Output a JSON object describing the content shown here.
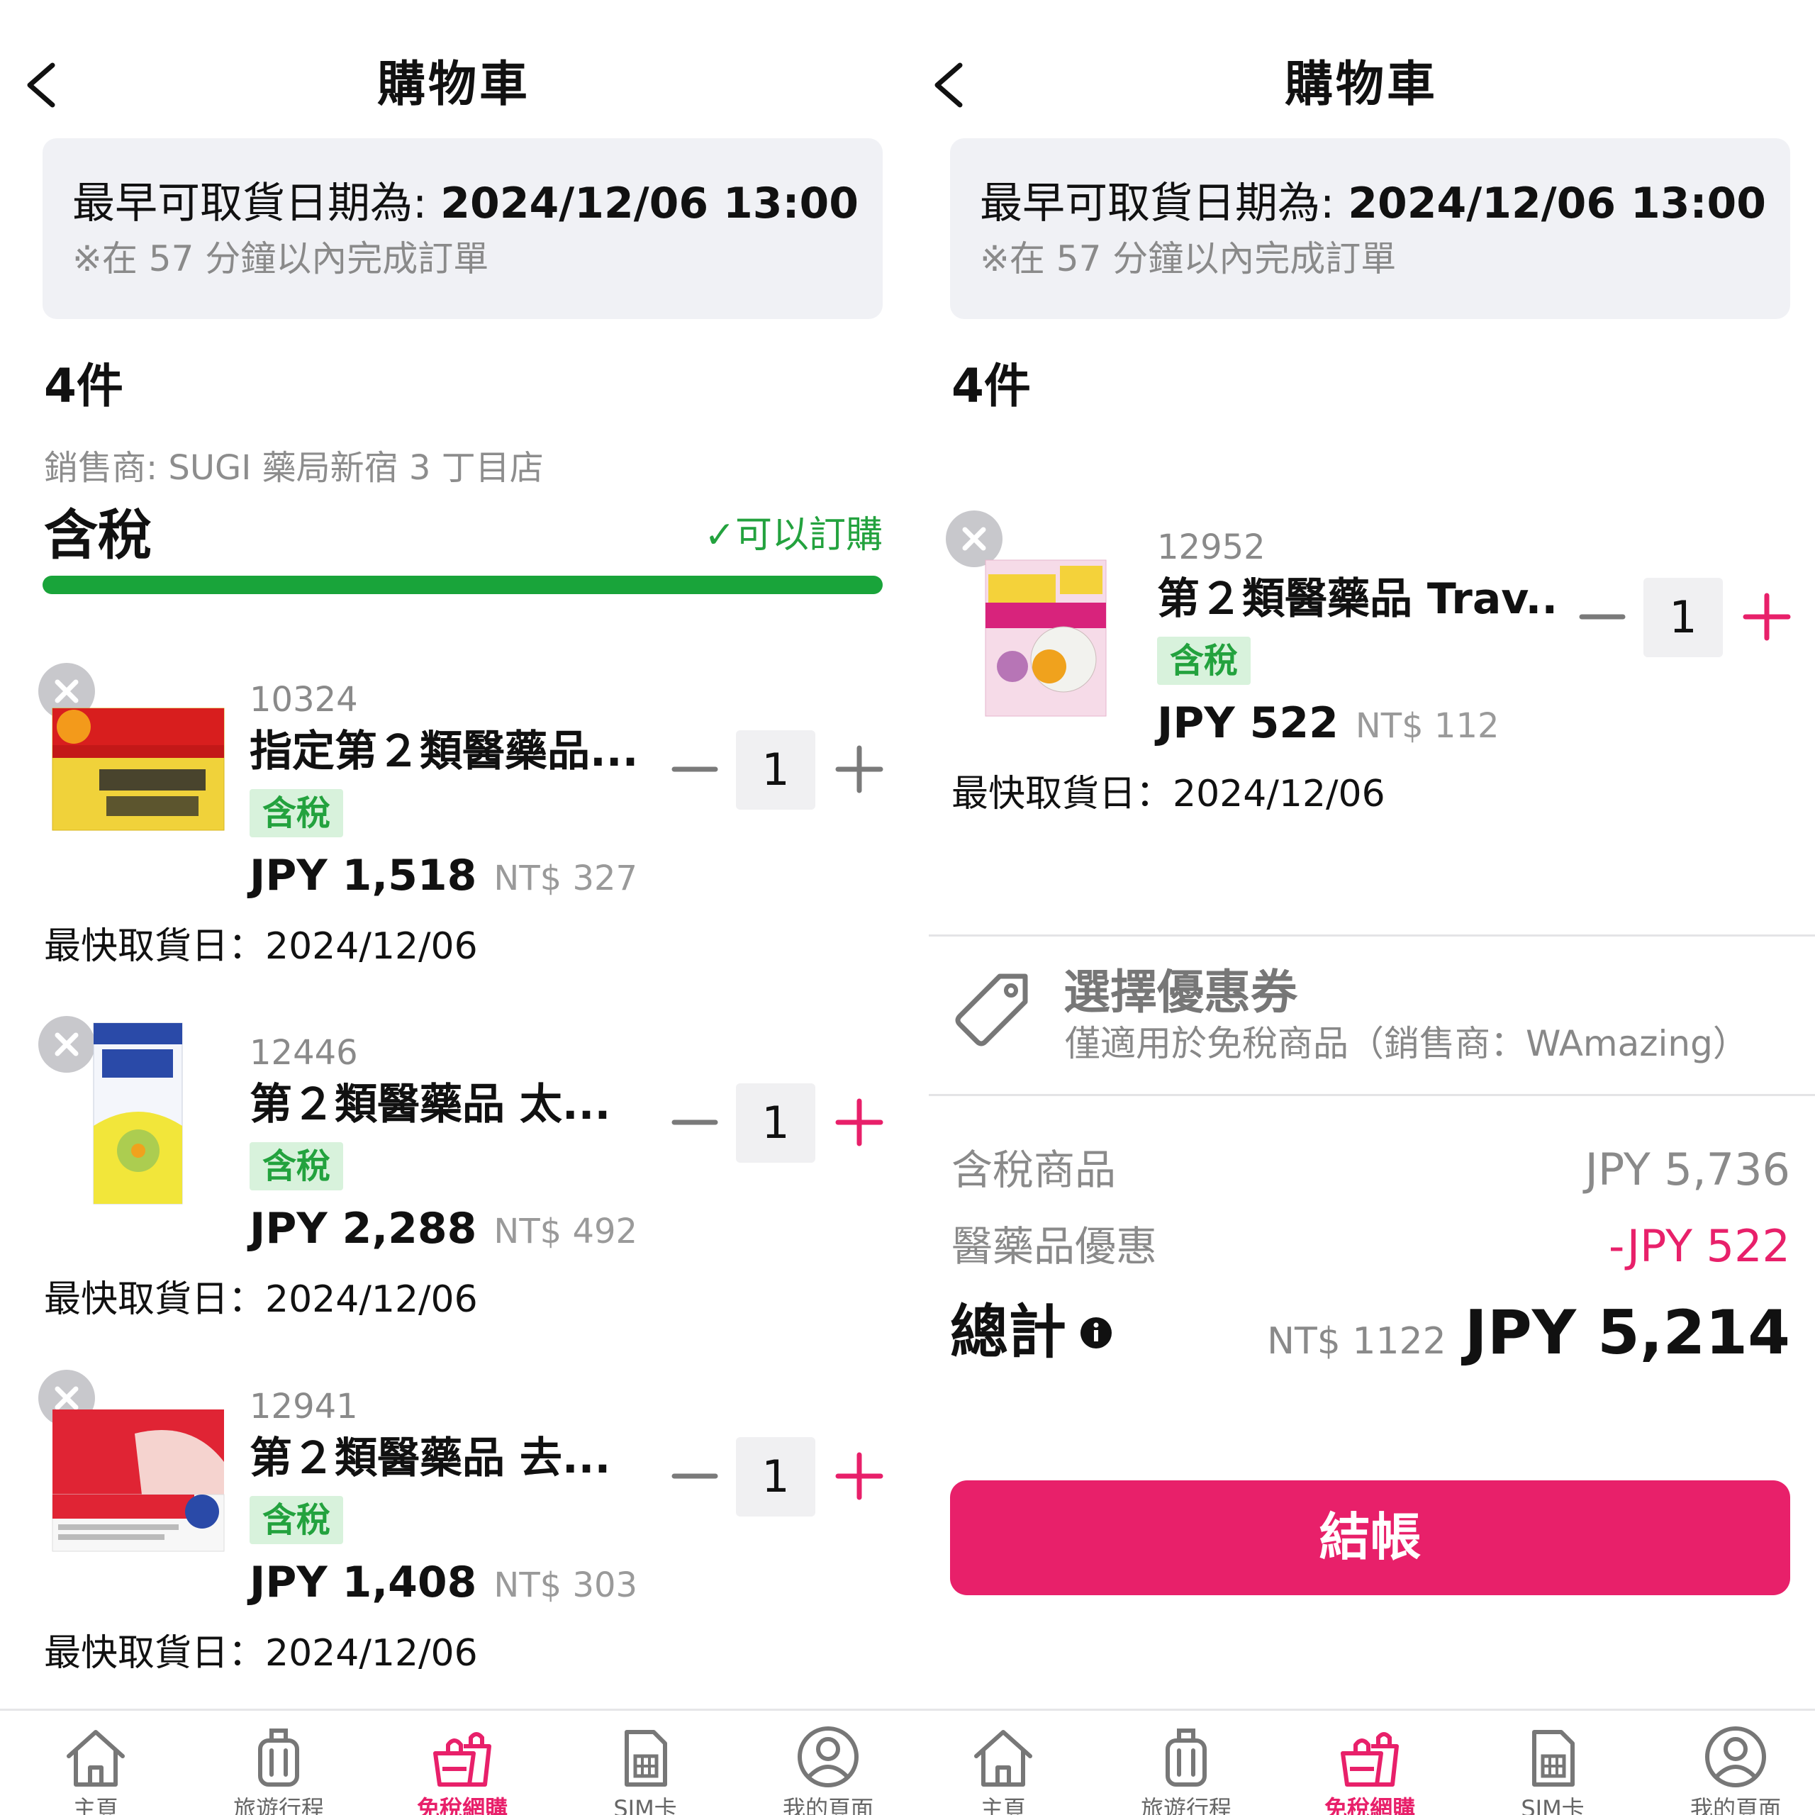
{
  "screens": [
    {
      "title": "購物車",
      "pickup": {
        "label": "最早可取貨日期為: ",
        "datetime": "2024/12/06 13:00",
        "note": "※在 57 分鐘以內完成訂單"
      },
      "count_label": "4件",
      "seller": "銷售商: SUGI 藥局新宿 3 丁目店",
      "section_title": "含稅",
      "orderable_label": "✓可以訂購",
      "items": [
        {
          "code": "10324",
          "name": "指定第２類醫藥品...",
          "tax_badge": "含稅",
          "price_jpy": "JPY 1,518",
          "price_ntd": "NT$ 327",
          "qty": "1",
          "pickup": "最快取貨日：2024/12/06"
        },
        {
          "code": "12446",
          "name": "第２類醫藥品 太...",
          "tax_badge": "含稅",
          "price_jpy": "JPY 2,288",
          "price_ntd": "NT$ 492",
          "qty": "1",
          "pickup": "最快取貨日：2024/12/06"
        },
        {
          "code": "12941",
          "name": "第２類醫藥品 去...",
          "tax_badge": "含稅",
          "price_jpy": "JPY 1,408",
          "price_ntd": "NT$ 303",
          "qty": "1",
          "pickup": "最快取貨日：2024/12/06"
        }
      ]
    },
    {
      "title": "購物車",
      "pickup": {
        "label": "最早可取貨日期為: ",
        "datetime": "2024/12/06 13:00",
        "note": "※在 57 分鐘以內完成訂單"
      },
      "count_label": "4件",
      "items": [
        {
          "code": "12952",
          "name": "第２類醫藥品 Trav...",
          "tax_badge": "含稅",
          "price_jpy": "JPY 522",
          "price_ntd": "NT$ 112",
          "qty": "1",
          "pickup": "最快取貨日：2024/12/06"
        }
      ],
      "coupon": {
        "title": "選擇優惠券",
        "subtitle": "僅適用於免稅商品（銷售商：WAmazing）"
      },
      "summary": {
        "taxed_label": "含稅商品",
        "taxed_value": "JPY 5,736",
        "discount_label": "醫藥品優惠",
        "discount_value": "-JPY 522",
        "total_label": "總計",
        "total_ntd": "NT$ 1122",
        "total_jpy": "JPY 5,214"
      },
      "checkout_label": "結帳"
    }
  ],
  "nav": [
    {
      "label": "主頁",
      "icon": "home-icon"
    },
    {
      "label": "旅遊行程",
      "icon": "suitcase-icon"
    },
    {
      "label": "免稅網購",
      "icon": "shopping-bag-icon",
      "active": true
    },
    {
      "label": "SIM卡",
      "icon": "sim-card-icon"
    },
    {
      "label": "我的頁面",
      "icon": "profile-icon"
    }
  ],
  "colors": {
    "accent": "#e8206a",
    "success": "#19a43a",
    "badge_bg": "#d8f2dc",
    "panel_bg": "#f0f1f5"
  }
}
